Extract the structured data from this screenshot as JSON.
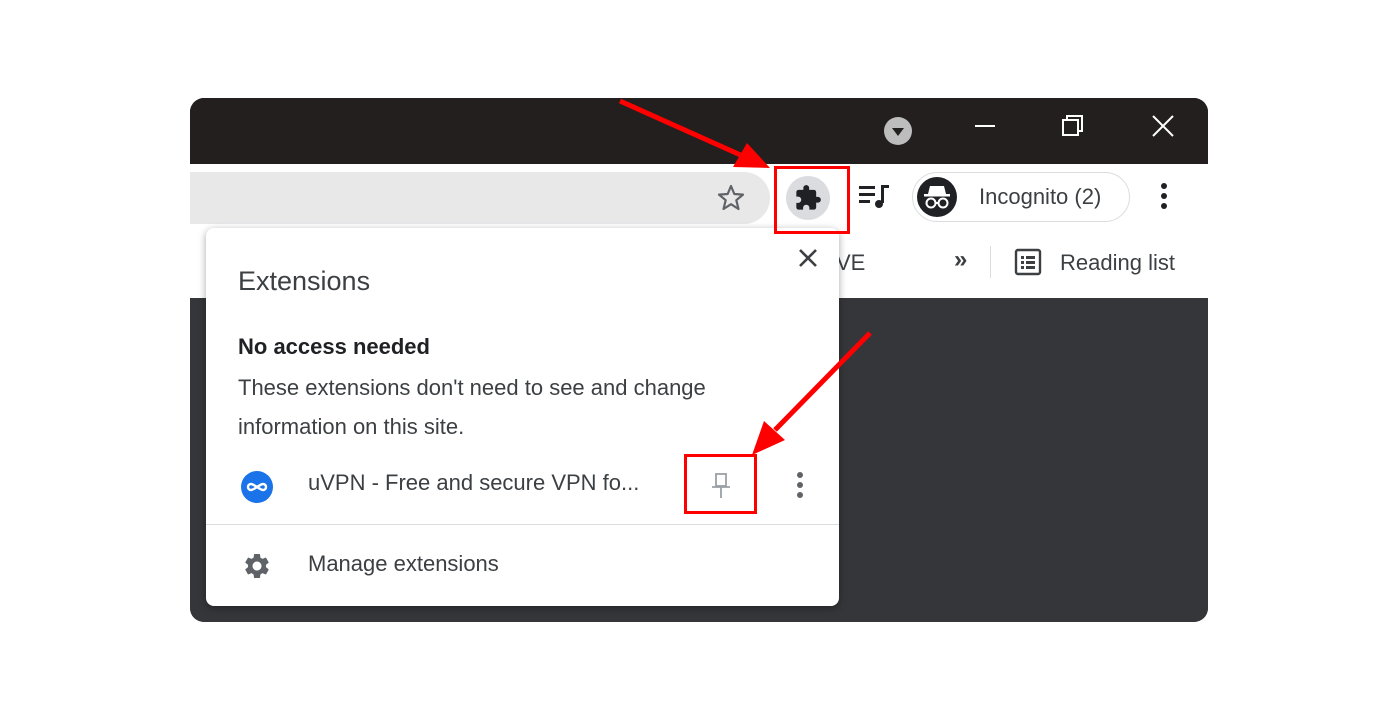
{
  "toolbar": {
    "incognito_label": "Incognito (2)"
  },
  "bookmarks": {
    "partial_item": "VE",
    "overflow": "»",
    "reading_list": "Reading list"
  },
  "extensions_panel": {
    "title": "Extensions",
    "section_heading": "No access needed",
    "section_description": "These extensions don't need to see and change information on this site.",
    "extension_name": "uVPN - Free and secure VPN fo...",
    "manage_label": "Manage extensions"
  },
  "icons": [
    "tab-search-icon",
    "minimize-icon",
    "restore-icon",
    "close-icon",
    "bookmark-star-icon",
    "puzzle-icon",
    "media-queue-icon",
    "incognito-icon",
    "more-vert-icon",
    "reading-list-icon",
    "uvpn-icon",
    "pin-icon",
    "gear-icon"
  ],
  "colors": {
    "highlight": "#ff0000",
    "uvpn_blue": "#1a73e8",
    "titlebar": "#231f1e",
    "content": "#35363a"
  }
}
